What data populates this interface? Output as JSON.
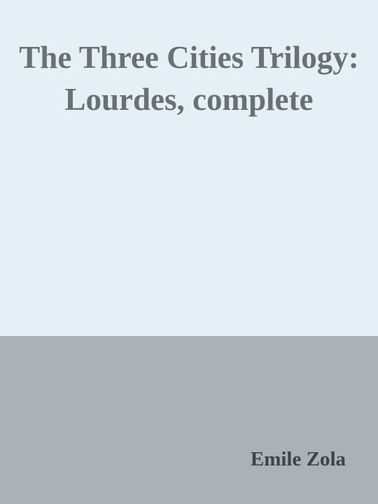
{
  "cover": {
    "title": "The Three Cities Trilogy: Lourdes, complete",
    "author": "Emile Zola"
  },
  "colors": {
    "top_background": "#e4f0f5",
    "bottom_background": "#aab2b5",
    "title_text": "#6a7175",
    "author_text": "#3e4346"
  }
}
